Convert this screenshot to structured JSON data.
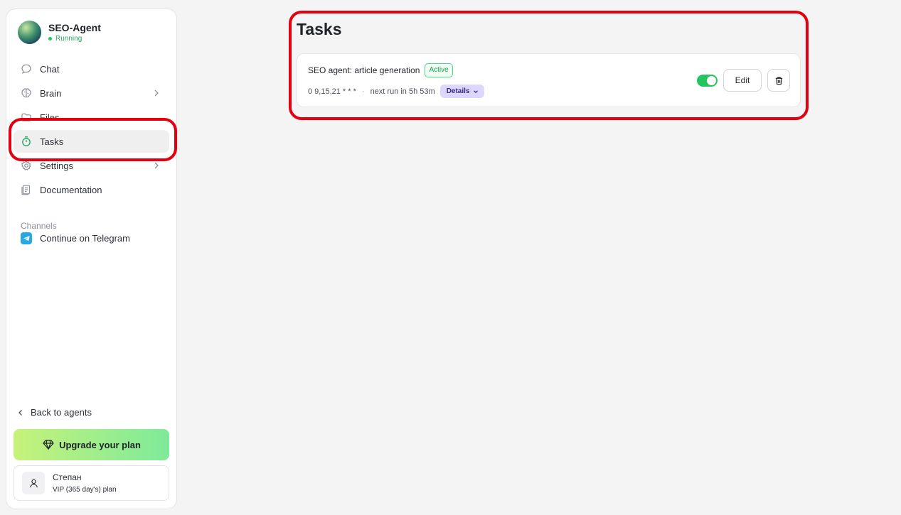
{
  "agent": {
    "name": "SEO-Agent",
    "status": "Running"
  },
  "nav": {
    "items": [
      {
        "label": "Chat",
        "icon": "chat-bubble-icon"
      },
      {
        "label": "Brain",
        "icon": "brain-icon"
      },
      {
        "label": "Files",
        "icon": "folder-icon"
      },
      {
        "label": "Tasks",
        "icon": "timer-icon"
      },
      {
        "label": "Settings",
        "icon": "gear-icon"
      },
      {
        "label": "Documentation",
        "icon": "document-icon"
      }
    ],
    "channels_label": "Channels",
    "telegram_label": "Continue on Telegram"
  },
  "footer": {
    "back_label": "Back to agents",
    "upgrade_label": "Upgrade your plan",
    "user_name": "Степан",
    "user_plan": "VIP (365 day's) plan"
  },
  "page": {
    "title": "Tasks"
  },
  "task": {
    "title": "SEO agent: article generation",
    "status": "Active",
    "schedule": "0 9,15,21 * * *",
    "separator": "·",
    "next_run": "next run in 5h 53m",
    "details_label": "Details",
    "enabled": true,
    "edit_label": "Edit"
  },
  "colors": {
    "accent_green": "#22c55e",
    "highlight_red": "#e3000f",
    "details_purple": "#ddd6fe",
    "telegram_blue": "#27a7e5"
  }
}
